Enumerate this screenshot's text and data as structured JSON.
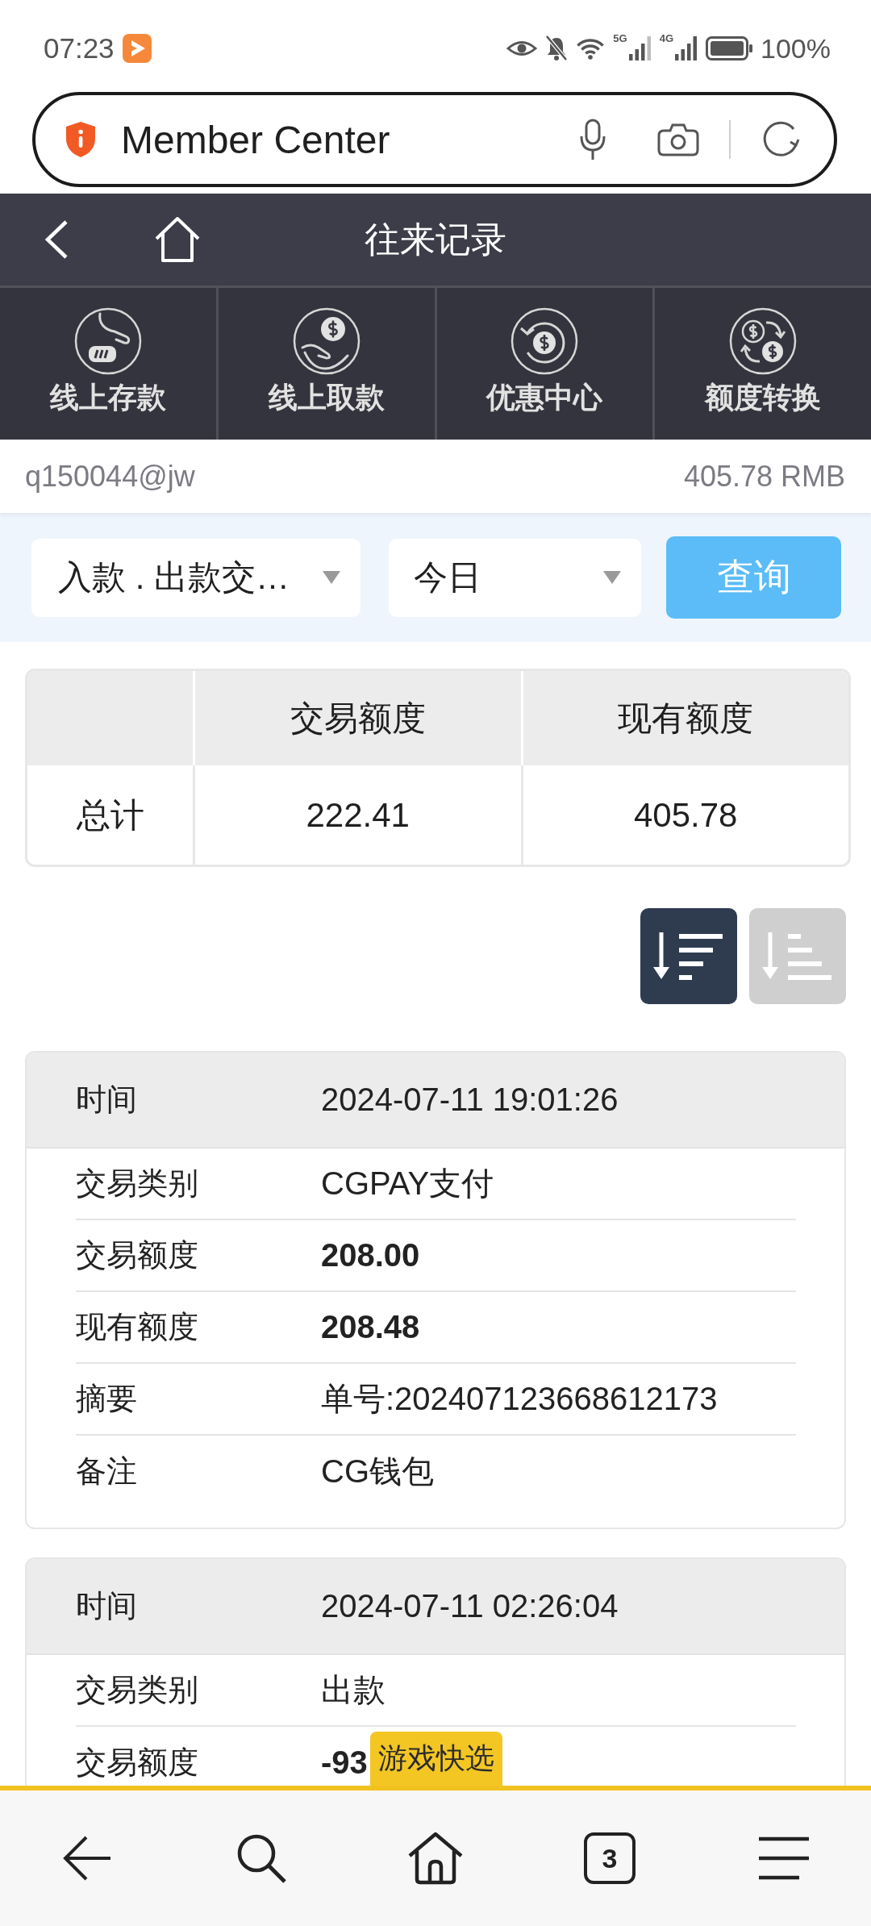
{
  "status_bar": {
    "time": "07:23",
    "network_types": [
      "5G",
      "4G"
    ],
    "battery": "100%"
  },
  "address_bar": {
    "title": "Member Center"
  },
  "header": {
    "title": "往来记录"
  },
  "shortcuts": [
    "线上存款",
    "线上取款",
    "优惠中心",
    "额度转换"
  ],
  "account": {
    "username": "q150044@jw",
    "balance": "405.78 RMB"
  },
  "filters": {
    "type_select": "入款 . 出款交…",
    "period_select": "今日",
    "query_button": "查询"
  },
  "summary": {
    "columns": [
      "交易额度",
      "现有额度"
    ],
    "rows": [
      {
        "label": "总计",
        "values": [
          "222.41",
          "405.78"
        ]
      }
    ]
  },
  "sort_buttons": [
    {
      "kind": "descending",
      "selected": true
    },
    {
      "kind": "ascending",
      "selected": false
    }
  ],
  "records": [
    {
      "header": {
        "label": "时间",
        "value": "2024-07-11 19:01:26"
      },
      "fields": [
        {
          "label": "交易类别",
          "value": "CGPAY支付",
          "kind": "text"
        },
        {
          "label": "交易额度",
          "value": "208.00",
          "kind": "amount"
        },
        {
          "label": "现有额度",
          "value": "208.48",
          "kind": "amount"
        },
        {
          "label": "摘要",
          "value": "单号:202407123668612173",
          "kind": "text"
        },
        {
          "label": "备注",
          "value": "CG钱包",
          "kind": "text"
        }
      ]
    },
    {
      "header": {
        "label": "时间",
        "value": "2024-07-11 02:26:04"
      },
      "fields": [
        {
          "label": "交易类别",
          "value": "出款",
          "kind": "text"
        },
        {
          "label": "交易额度",
          "value": "-93",
          "kind": "amount"
        }
      ]
    }
  ],
  "floating_tab": {
    "label": "游戏快选"
  },
  "bottom_nav": {
    "tab_count": "3"
  }
}
